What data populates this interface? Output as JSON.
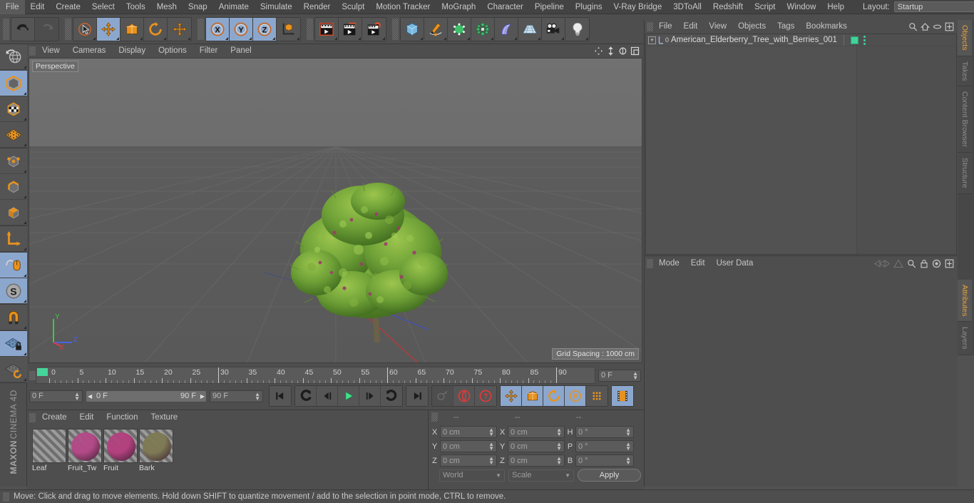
{
  "menubar": {
    "items": [
      "File",
      "Edit",
      "Create",
      "Select",
      "Tools",
      "Mesh",
      "Snap",
      "Animate",
      "Simulate",
      "Render",
      "Sculpt",
      "Motion Tracker",
      "MoGraph",
      "Character",
      "Pipeline",
      "Plugins",
      "V-Ray Bridge",
      "3DToAll",
      "Redshift",
      "Script",
      "Window",
      "Help"
    ],
    "layout_label": "Layout:",
    "layout_value": "Startup",
    "search_icon": "search-icon"
  },
  "toolbar": {
    "groups": [
      {
        "name": "history",
        "buttons": [
          {
            "name": "undo-button",
            "icon": "undo-icon",
            "active": false,
            "disabled": false
          },
          {
            "name": "redo-button",
            "icon": "redo-icon",
            "active": false,
            "disabled": true
          }
        ]
      },
      {
        "name": "transform",
        "buttons": [
          {
            "name": "live-selection-tool",
            "icon": "cursor-circle-icon",
            "active": false,
            "disabled": false
          },
          {
            "name": "move-tool",
            "icon": "move-arrows-icon",
            "active": true,
            "disabled": false
          },
          {
            "name": "scale-tool",
            "icon": "scale-box-icon",
            "active": false,
            "disabled": false
          },
          {
            "name": "rotate-tool",
            "icon": "rotate-circle-icon",
            "active": false,
            "disabled": false
          },
          {
            "name": "axis-move-tool",
            "icon": "move-arrows-icon",
            "active": false,
            "disabled": false
          }
        ]
      },
      {
        "name": "axis-locks",
        "buttons": [
          {
            "name": "lock-x-axis",
            "icon": "x-axis-icon",
            "active": true,
            "disabled": false
          },
          {
            "name": "lock-y-axis",
            "icon": "y-axis-icon",
            "active": true,
            "disabled": false
          },
          {
            "name": "lock-z-axis",
            "icon": "z-axis-icon",
            "active": true,
            "disabled": false
          },
          {
            "name": "world-object-coords",
            "icon": "world-axis-cube-icon",
            "active": false,
            "disabled": false
          }
        ]
      },
      {
        "name": "render",
        "buttons": [
          {
            "name": "render-view-button",
            "icon": "render-view-icon",
            "active": false,
            "disabled": false
          },
          {
            "name": "render-to-picture-viewer-button",
            "icon": "render-picture-icon",
            "active": false,
            "disabled": false
          },
          {
            "name": "render-settings-button",
            "icon": "render-settings-icon",
            "active": false,
            "disabled": false
          }
        ]
      },
      {
        "name": "create",
        "buttons": [
          {
            "name": "add-primitive-button",
            "icon": "cube-icon",
            "active": false,
            "disabled": false
          },
          {
            "name": "add-spline-button",
            "icon": "pen-spline-icon",
            "active": false,
            "disabled": false
          },
          {
            "name": "add-generator-button",
            "icon": "generator-cube-icon",
            "active": false,
            "disabled": false
          },
          {
            "name": "add-deformer-button",
            "icon": "deformer-icon",
            "active": false,
            "disabled": false
          },
          {
            "name": "add-mograph-button",
            "icon": "bend-shape-icon",
            "active": false,
            "disabled": false
          },
          {
            "name": "add-scene-object-button",
            "icon": "floor-grid-icon",
            "active": false,
            "disabled": false
          },
          {
            "name": "add-camera-button",
            "icon": "camera-icon",
            "active": false,
            "disabled": false
          },
          {
            "name": "add-light-button",
            "icon": "light-bulb-icon",
            "active": false,
            "disabled": false
          }
        ]
      }
    ]
  },
  "leftbar": {
    "buttons": [
      {
        "name": "undo-view-button",
        "icon": "globe-undo-icon",
        "active": false
      },
      {
        "name": "model-mode-button",
        "icon": "model-cube-icon",
        "active": true
      },
      {
        "name": "texture-mode-button",
        "icon": "texture-checker-icon",
        "active": false
      },
      {
        "name": "workplane-mode-button",
        "icon": "workplane-grid-icon",
        "active": false
      },
      {
        "name": "points-mode-button",
        "icon": "points-cube-icon",
        "active": false
      },
      {
        "name": "edges-mode-button",
        "icon": "edges-cube-icon",
        "active": false
      },
      {
        "name": "polygons-mode-button",
        "icon": "polygons-cube-icon",
        "active": false
      },
      {
        "name": "object-axis-mode-button",
        "icon": "axis-L-icon",
        "active": false
      },
      {
        "name": "enable-axis-button",
        "icon": "mouse-axis-icon",
        "active": true
      },
      {
        "name": "snap-settings-button",
        "icon": "snap-S-icon",
        "active": true
      },
      {
        "name": "magnet-tool-button",
        "icon": "magnet-icon",
        "active": false
      },
      {
        "name": "workplane-lock-button",
        "icon": "workplane-lock-icon",
        "active": true
      },
      {
        "name": "workplane-toggle-button",
        "icon": "workplane-rotate-icon",
        "active": false
      }
    ],
    "brand_bold": "MAXON",
    "brand_text": "CINEMA 4D"
  },
  "viewport": {
    "menu": [
      "View",
      "Cameras",
      "Display",
      "Options",
      "Filter",
      "Panel"
    ],
    "nav_icons": [
      "pan-icon",
      "dolly-icon",
      "rotate-icon",
      "maximize-icon"
    ],
    "perspective_label": "Perspective",
    "grid_spacing": "Grid Spacing : 1000 cm",
    "axis": {
      "x": "X",
      "y": "Y",
      "z": "Z",
      "x_color": "#d64040",
      "y_color": "#3fc93f",
      "z_color": "#4a63e0"
    }
  },
  "timeline": {
    "ticks": [
      "0",
      "5",
      "10",
      "15",
      "20",
      "25",
      "30",
      "35",
      "40",
      "45",
      "50",
      "55",
      "60",
      "65",
      "70",
      "75",
      "80",
      "85",
      "90"
    ],
    "current_frame_field": "0 F",
    "start_frame_field": "0 F",
    "range_start": "0 F",
    "range_end": "90 F",
    "end_frame_field": "90 F",
    "playback": [
      {
        "name": "goto-start-button",
        "icon": "skip-start-icon",
        "active": false,
        "disabled": false
      },
      {
        "name": "previous-key-button",
        "icon": "prev-key-icon",
        "active": false,
        "disabled": false
      },
      {
        "name": "step-back-button",
        "icon": "step-back-icon",
        "active": false,
        "disabled": false
      },
      {
        "name": "play-button",
        "icon": "play-icon",
        "active": false,
        "disabled": false
      },
      {
        "name": "step-forward-button",
        "icon": "step-forward-icon",
        "active": false,
        "disabled": false
      },
      {
        "name": "next-key-button",
        "icon": "next-key-icon",
        "active": false,
        "disabled": false
      },
      {
        "name": "goto-end-button",
        "icon": "skip-end-icon",
        "active": false,
        "disabled": false
      }
    ],
    "keys": [
      {
        "name": "record-active-objects-button",
        "icon": "key-icon",
        "active": false,
        "disabled": true
      },
      {
        "name": "autokeying-button",
        "icon": "autokey-red-icon",
        "active": false,
        "disabled": false
      },
      {
        "name": "keyframe-selection-button",
        "icon": "question-red-icon",
        "active": false,
        "disabled": false
      }
    ],
    "key_toggles": [
      {
        "name": "key-position-button",
        "icon": "move-arrows-icon",
        "active": true
      },
      {
        "name": "key-scale-button",
        "icon": "scale-box-icon",
        "active": true
      },
      {
        "name": "key-rotation-button",
        "icon": "rotate-circle-icon",
        "active": true
      },
      {
        "name": "key-parameter-button",
        "icon": "param-P-icon",
        "active": true
      },
      {
        "name": "key-point-level-button",
        "icon": "pla-dots-icon",
        "active": false
      },
      {
        "name": "timeline-filmstrip-button",
        "icon": "filmstrip-icon",
        "active": true
      }
    ]
  },
  "materials": {
    "menu": [
      "Create",
      "Edit",
      "Function",
      "Texture"
    ],
    "items": [
      {
        "name": "Leaf",
        "color": "transparent",
        "kind": "alpha"
      },
      {
        "name": "Fruit_Tw",
        "color": "#b24a87",
        "kind": "sphere"
      },
      {
        "name": "Fruit",
        "color": "#b2417f",
        "kind": "sphere"
      },
      {
        "name": "Bark",
        "color": "#7e7a55",
        "kind": "sphere"
      }
    ]
  },
  "coordinates": {
    "header_dashes": [
      "--",
      "--",
      "--"
    ],
    "position": {
      "label_x": "X",
      "label_y": "Y",
      "label_z": "Z",
      "x": "0 cm",
      "y": "0 cm",
      "z": "0 cm"
    },
    "size": {
      "label_x": "X",
      "label_y": "Y",
      "label_z": "Z",
      "x": "0 cm",
      "y": "0 cm",
      "z": "0 cm"
    },
    "rotation": {
      "label_h": "H",
      "label_p": "P",
      "label_b": "B",
      "h": "0 °",
      "p": "0 °",
      "b": "0 °"
    },
    "coord_system": "World",
    "transform_mode": "Scale",
    "apply_label": "Apply"
  },
  "object_manager": {
    "menu": [
      "File",
      "Edit",
      "View",
      "Objects",
      "Tags",
      "Bookmarks"
    ],
    "icons": [
      "search-icon",
      "home-icon",
      "ellipse-icon",
      "plus-box-icon"
    ],
    "rows": [
      {
        "name": "American_Elderberry_Tree_with_Berries_001",
        "layer": "0",
        "tag": "green-tag"
      }
    ]
  },
  "attributes": {
    "menu": [
      "Mode",
      "Edit",
      "User Data"
    ],
    "icons": [
      "nav-left-icon",
      "nav-up-icon",
      "search-icon",
      "lock-icon",
      "target-icon",
      "plus-box-icon"
    ]
  },
  "vertical_tabs": {
    "top": [
      {
        "label": "Objects",
        "selected": true
      },
      {
        "label": "Takes",
        "selected": false
      },
      {
        "label": "Content Browser",
        "selected": false
      },
      {
        "label": "Structure",
        "selected": false
      }
    ],
    "bottom": [
      {
        "label": "Attributes",
        "selected": true
      },
      {
        "label": "Layers",
        "selected": false
      }
    ]
  },
  "statusbar": {
    "text": "Move: Click and drag to move elements. Hold down SHIFT to quantize movement / add to the selection in point mode, CTRL to remove."
  }
}
